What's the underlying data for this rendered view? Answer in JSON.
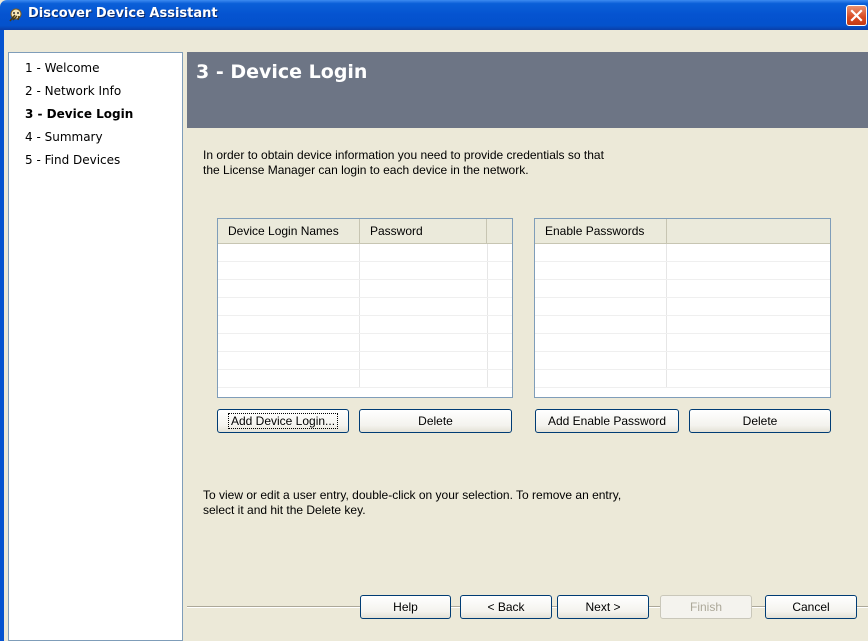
{
  "window": {
    "title": "Discover Device Assistant",
    "icon": "wizard-icon",
    "close_icon": "close-icon"
  },
  "sidebar": {
    "items": [
      {
        "label": "1 - Welcome",
        "active": false
      },
      {
        "label": "2 - Network Info",
        "active": false
      },
      {
        "label": "3 - Device Login",
        "active": true
      },
      {
        "label": "4 - Summary",
        "active": false
      },
      {
        "label": "5 - Find Devices",
        "active": false
      }
    ]
  },
  "header": {
    "title": "3 - Device Login",
    "band_color": "#6d7585"
  },
  "intro": {
    "line1": "In order to obtain device information you need to provide credentials so that",
    "line2": "the License Manager can login to each device in the network."
  },
  "login_table": {
    "columns": [
      "Device Login Names",
      "Password"
    ],
    "rows": []
  },
  "enable_table": {
    "columns": [
      "Enable Passwords"
    ],
    "rows": []
  },
  "buttons": {
    "add_device_login": "Add Device Login...",
    "delete_login": "Delete",
    "add_enable_password": "Add Enable Password",
    "delete_enable": "Delete"
  },
  "hint": {
    "line1": "To view or edit a user entry, double-click on your selection. To remove an entry,",
    "line2": "select it and hit the Delete key."
  },
  "footer": {
    "help": "Help",
    "back": "< Back",
    "next": "Next >",
    "finish": "Finish",
    "cancel": "Cancel"
  }
}
